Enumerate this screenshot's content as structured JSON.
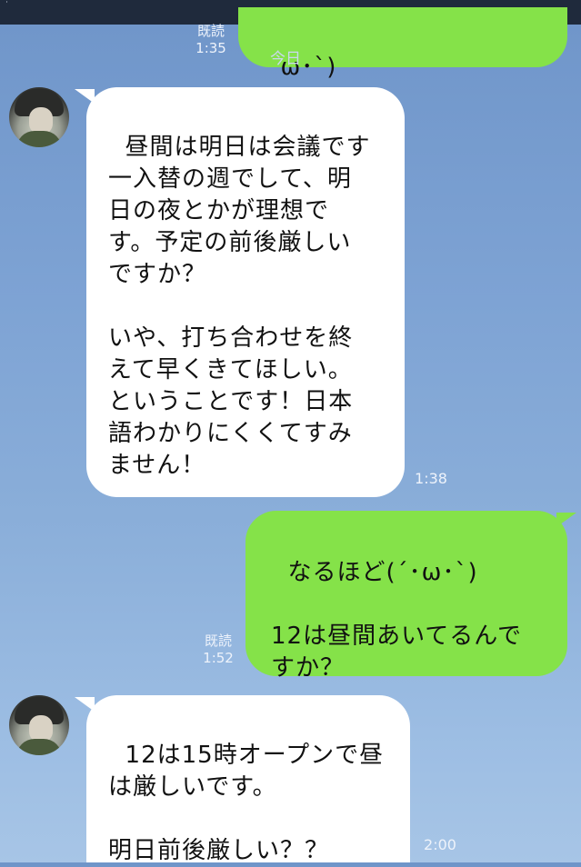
{
  "status_bar": {
    "corner_glyph": "ᐧ"
  },
  "messages": {
    "m0": {
      "text": "ω･`)",
      "read_label": "既読",
      "time": "1:35"
    },
    "date_label": "今日",
    "m1": {
      "text": "昼間は明日は会議です\n一入替の週でして、明\n日の夜とかが理想で\nす。予定の前後厳しい\nですか？\n\nいや、打ち合わせを終\nえて早くきてほしい。\nということです！日本\n語わかりにくくてすみ\nません！",
      "time": "1:38"
    },
    "m2": {
      "text": "なるほど(´･ω･`)\n\n12は昼間あいてるんで\nすか？",
      "read_label": "既読",
      "time": "1:52"
    },
    "m3": {
      "text": "12は15時オープンで昼\nは厳しいです。\n\n明日前後厳しい？？",
      "time": "2:00"
    }
  }
}
